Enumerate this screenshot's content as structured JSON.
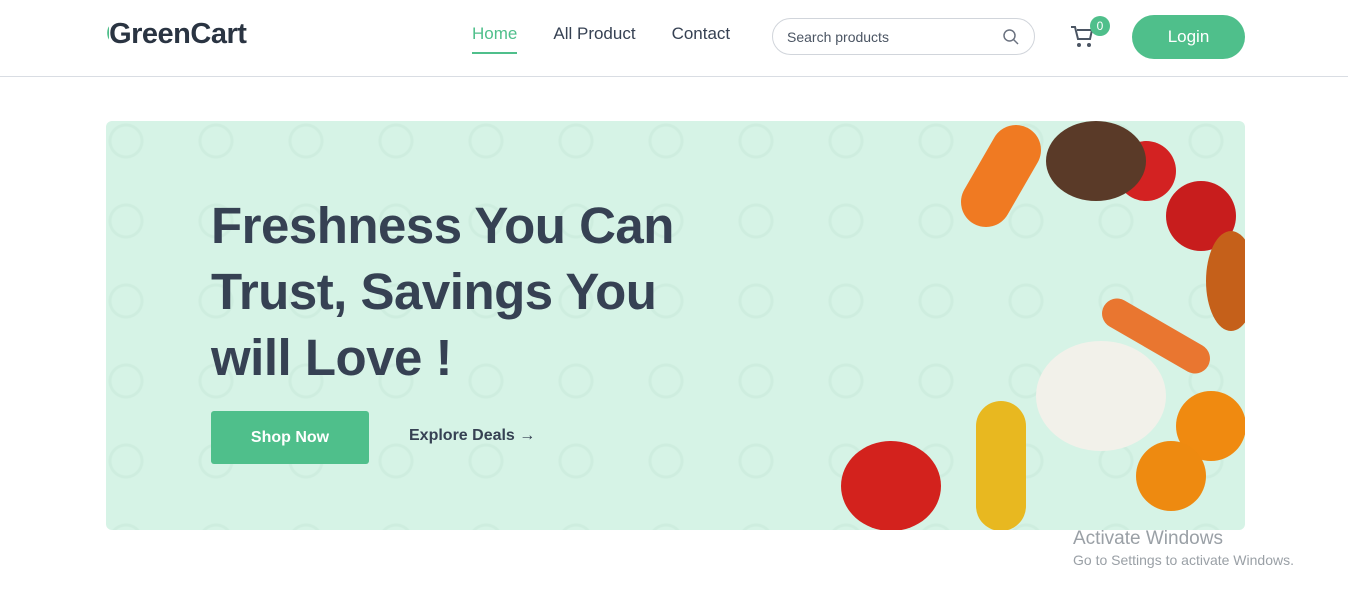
{
  "nav": {
    "logo": "GreenCart",
    "links": [
      "Home",
      "All Product",
      "Contact"
    ],
    "search_placeholder": "Search products",
    "cart_count": "0",
    "login": "Login"
  },
  "hero": {
    "title": "Freshness You Can Trust, Savings You will Love !",
    "shop_now": "Shop Now",
    "explore": "Explore Deals"
  },
  "watermark": {
    "title": "Activate Windows",
    "subtitle": "Go to Settings to activate Windows."
  },
  "colors": {
    "accent": "#4fbf8b",
    "banner": "#d6f3e6",
    "text": "#364153"
  }
}
